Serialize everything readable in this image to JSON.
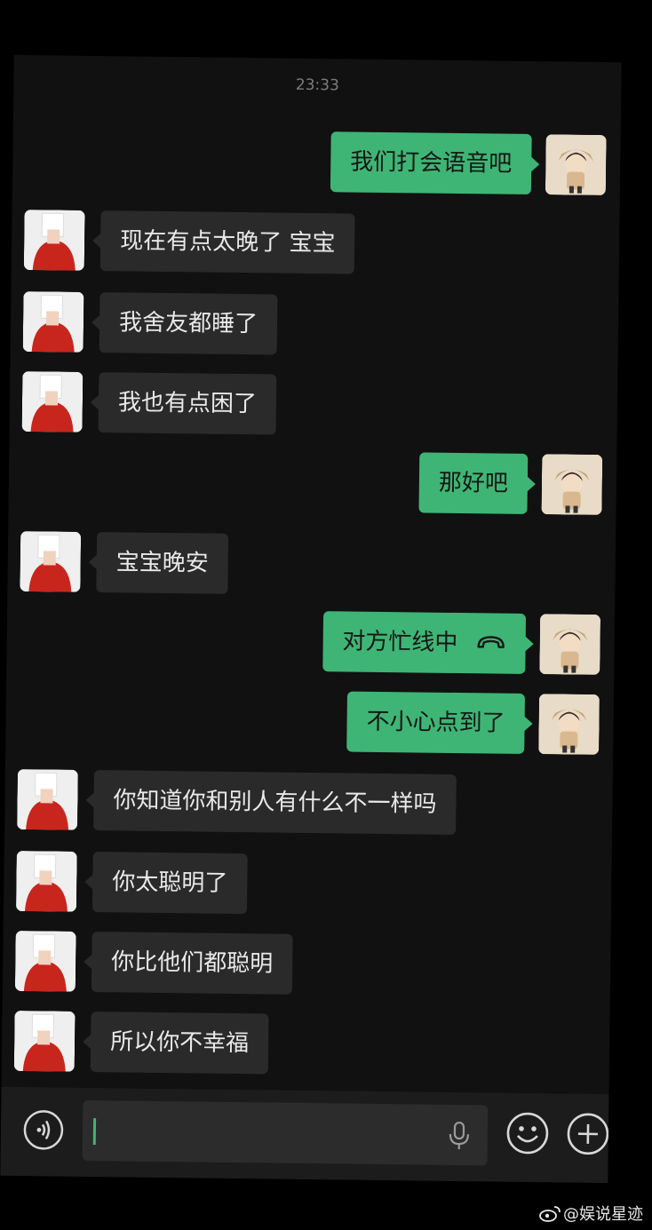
{
  "header": {
    "time": "23:33"
  },
  "messages": [
    {
      "side": "out",
      "text": "我们打会语音吧"
    },
    {
      "side": "in",
      "text": "现在有点太晚了 宝宝"
    },
    {
      "side": "in",
      "text": "我舍友都睡了"
    },
    {
      "side": "in",
      "text": "我也有点困了"
    },
    {
      "side": "out",
      "text": "那好吧"
    },
    {
      "side": "in",
      "text": "宝宝晚安"
    },
    {
      "side": "out",
      "text": "对方忙线中",
      "icon": "hangup-icon"
    },
    {
      "side": "out",
      "text": "不小心点到了"
    },
    {
      "side": "in",
      "text": "你知道你和别人有什么不一样吗"
    },
    {
      "side": "in",
      "text": "你太聪明了"
    },
    {
      "side": "in",
      "text": "你比他们都聪明"
    },
    {
      "side": "in",
      "text": "所以你不幸福"
    }
  ],
  "input_bar": {
    "voice_icon": "voice-mode-icon",
    "mic_icon": "microphone-icon",
    "emoji_icon": "emoji-icon",
    "plus_icon": "plus-icon",
    "value": ""
  },
  "watermark": {
    "text": "@娱说星迹",
    "icon": "weibo-icon"
  },
  "colors": {
    "outgoing_bubble": "#3eb575",
    "incoming_bubble": "#2a2a2a",
    "background": "#111111"
  }
}
